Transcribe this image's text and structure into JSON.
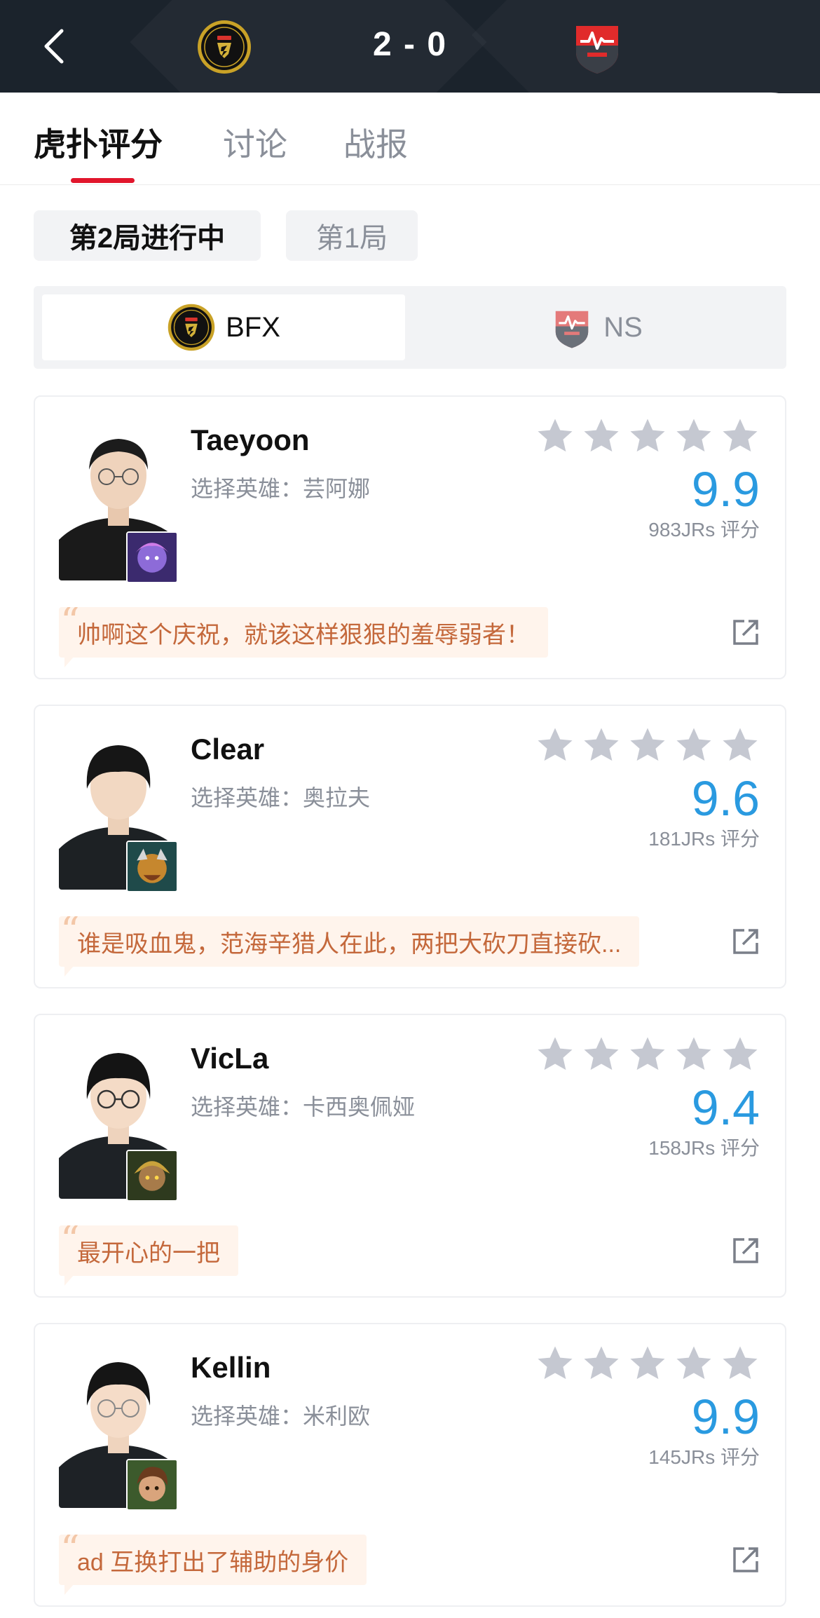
{
  "header": {
    "score": "2 - 0",
    "left_team_logo": "fearx-logo",
    "right_team_logo": "nongshim-redforce-logo"
  },
  "tabs": [
    {
      "label": "虎扑评分",
      "active": true
    },
    {
      "label": "讨论",
      "active": false
    },
    {
      "label": "战报",
      "active": false
    }
  ],
  "rounds": [
    {
      "label": "第2局进行中",
      "active": true
    },
    {
      "label": "第1局",
      "active": false
    }
  ],
  "teams": [
    {
      "name": "BFX",
      "active": true
    },
    {
      "name": "NS",
      "active": false
    }
  ],
  "players": [
    {
      "name": "Taeyoon",
      "champion": "选择英雄：芸阿娜",
      "stars": 5,
      "score": "9.9",
      "count": "983JRs 评分",
      "comment": "帅啊这个庆祝，就该这样狠狠的羞辱弱者！"
    },
    {
      "name": "Clear",
      "champion": "选择英雄：奥拉夫",
      "stars": 5,
      "score": "9.6",
      "count": "181JRs 评分",
      "comment": "谁是吸血鬼，范海辛猎人在此，两把大砍刀直接砍..."
    },
    {
      "name": "VicLa",
      "champion": "选择英雄：卡西奥佩娅",
      "stars": 5,
      "score": "9.4",
      "count": "158JRs 评分",
      "comment": "最开心的一把"
    },
    {
      "name": "Kellin",
      "champion": "选择英雄：米利欧",
      "stars": 5,
      "score": "9.9",
      "count": "145JRs 评分",
      "comment": "ad 互换打出了辅助的身价"
    }
  ],
  "colors": {
    "header_bg": "#1b232c",
    "accent_red": "#e1162c",
    "score_blue": "#2a9ae0",
    "comment_text": "#c4683b",
    "comment_bg": "#fff4ec",
    "star_gray": "#c5c8d1"
  }
}
